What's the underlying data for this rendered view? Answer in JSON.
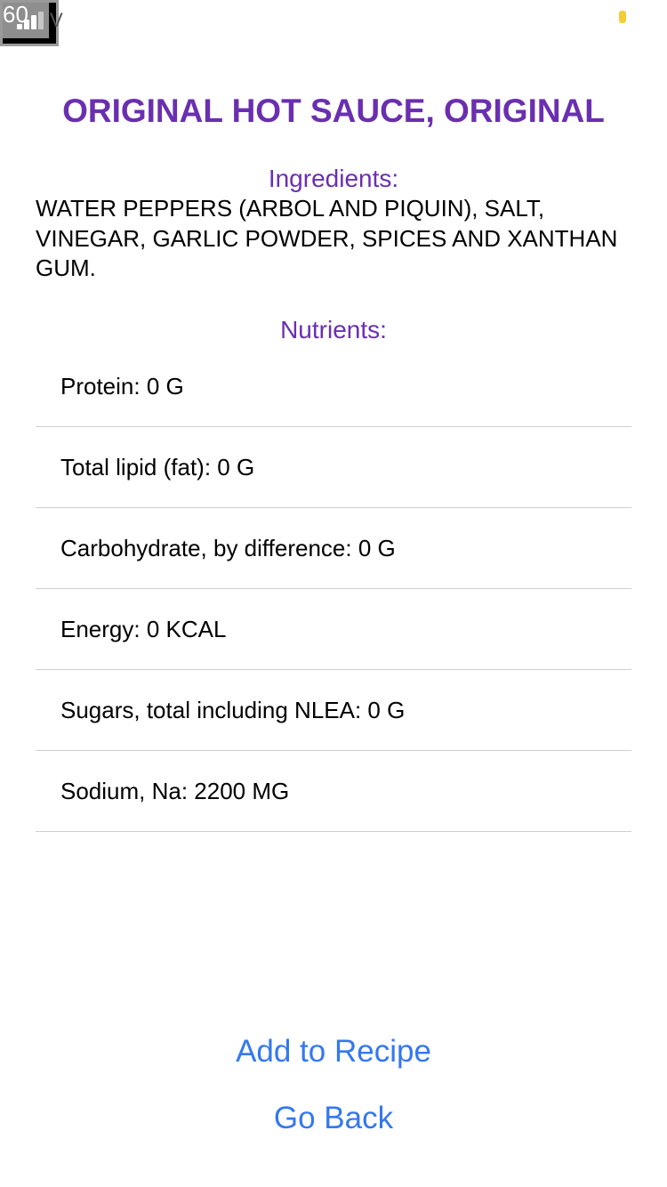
{
  "status_bar": {
    "debug_label": "60",
    "carrier_glyph": "V"
  },
  "product": {
    "title": "ORIGINAL HOT SAUCE, ORIGINAL"
  },
  "ingredients": {
    "heading": "Ingredients:",
    "text": "WATER PEPPERS (ARBOL AND PIQUIN), SALT, VINEGAR, GARLIC POWDER, SPICES AND XANTHAN GUM."
  },
  "nutrients": {
    "heading": "Nutrients:",
    "items": [
      "Protein: 0 G",
      "Total lipid (fat): 0 G",
      "Carbohydrate, by difference: 0 G",
      "Energy: 0 KCAL",
      "Sugars, total including NLEA: 0 G",
      "Sodium, Na: 2200 MG"
    ]
  },
  "actions": {
    "add_label": "Add to Recipe",
    "back_label": "Go Back"
  },
  "colors": {
    "accent_purple": "#6a2fb0",
    "link_blue": "#3478f0",
    "battery_yellow": "#f2cd36"
  }
}
